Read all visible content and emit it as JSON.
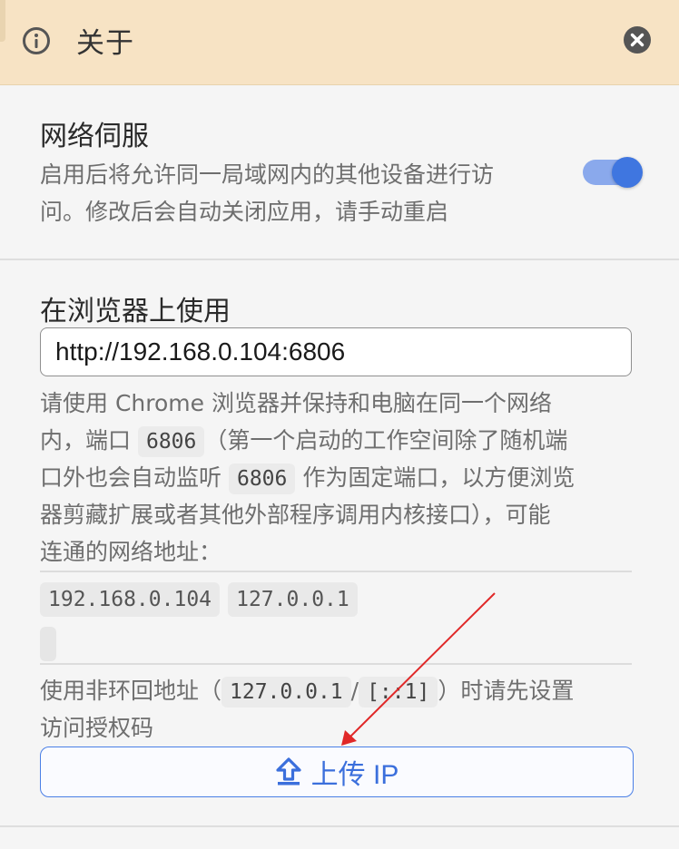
{
  "header": {
    "title": "关于",
    "info_icon": "info-circle-icon",
    "close_icon": "close-circle-icon",
    "background": "#f7e3c4"
  },
  "network_service": {
    "title": "网络伺服",
    "description_line1": "启用后将允许同一局域网内的其他设备进行访",
    "description_line2": "问。修改后会自动关闭应用，请手动重启",
    "enabled": true,
    "toggle_color": "#3f76e0"
  },
  "browser": {
    "title": "在浏览器上使用",
    "url": "http://192.168.0.104:6806",
    "desc_line1": "请使用 Chrome 浏览器并保持和电脑在同一个网络",
    "desc_line2_a": "内，端口",
    "port": "6806",
    "desc_line2_b": "（第一个启动的工作空间除了随机端",
    "desc_line3_a": "口外也会自动监听",
    "desc_line3_b": "作为固定端口，以方便浏览",
    "desc_line4": "器剪藏扩展或者其他外部程序调用内核接口），可能",
    "desc_line5": "连通的网络地址：",
    "addresses": [
      "192.168.0.104",
      "127.0.0.1"
    ],
    "auth_a": "使用非环回地址（",
    "loopback_v4": "127.0.0.1",
    "sep": "/",
    "loopback_v6": "[::1]",
    "auth_b": "）时请先设置",
    "auth_line2": "访问授权码",
    "upload_label": "上传 IP",
    "upload_icon": "upload-icon",
    "accent": "#3b6fdc"
  },
  "annotation": {
    "arrow_color": "#e02828"
  }
}
